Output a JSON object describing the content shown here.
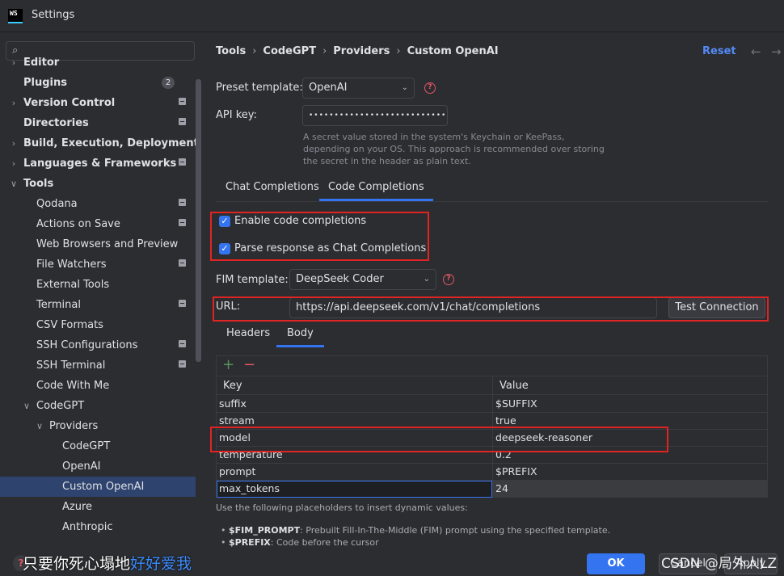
{
  "window": {
    "logo_text": "WS",
    "title": "Settings"
  },
  "sidebar": {
    "search": {
      "placeholder": ""
    },
    "items": [
      {
        "label": "Editor",
        "chevron": "›",
        "bold": true,
        "badge": false
      },
      {
        "label": "Plugins",
        "chevron": "",
        "bold": true,
        "count": "2"
      },
      {
        "label": "Version Control",
        "chevron": "›",
        "bold": true,
        "badge": true
      },
      {
        "label": "Directories",
        "chevron": "",
        "bold": true,
        "badge": true
      },
      {
        "label": "Build, Execution, Deployment",
        "chevron": "›",
        "bold": true,
        "badge": false
      },
      {
        "label": "Languages & Frameworks",
        "chevron": "›",
        "bold": true,
        "badge": true
      },
      {
        "label": "Tools",
        "chevron": "⌄",
        "bold": true,
        "badge": false
      },
      {
        "label": "Qodana",
        "chevron": "",
        "bold": false,
        "badge": true
      },
      {
        "label": "Actions on Save",
        "chevron": "",
        "bold": false,
        "badge": true
      },
      {
        "label": "Web Browsers and Preview",
        "chevron": "",
        "bold": false,
        "badge": false
      },
      {
        "label": "File Watchers",
        "chevron": "",
        "bold": false,
        "badge": true
      },
      {
        "label": "External Tools",
        "chevron": "",
        "bold": false,
        "badge": false
      },
      {
        "label": "Terminal",
        "chevron": "",
        "bold": false,
        "badge": true
      },
      {
        "label": "CSV Formats",
        "chevron": "",
        "bold": false,
        "badge": false
      },
      {
        "label": "SSH Configurations",
        "chevron": "",
        "bold": false,
        "badge": true
      },
      {
        "label": "SSH Terminal",
        "chevron": "",
        "bold": false,
        "badge": true
      },
      {
        "label": "Code With Me",
        "chevron": "",
        "bold": false,
        "badge": false
      },
      {
        "label": "CodeGPT",
        "chevron": "⌄",
        "bold": false,
        "badge": false
      },
      {
        "label": "Providers",
        "chevron": "⌄",
        "bold": false,
        "badge": false
      },
      {
        "label": "CodeGPT",
        "chevron": "",
        "bold": false,
        "badge": false
      },
      {
        "label": "OpenAI",
        "chevron": "",
        "bold": false,
        "badge": false
      },
      {
        "label": "Custom OpenAI",
        "chevron": "",
        "bold": false,
        "badge": false,
        "selected": true
      },
      {
        "label": "Azure",
        "chevron": "",
        "bold": false,
        "badge": false
      },
      {
        "label": "Anthropic",
        "chevron": "",
        "bold": false,
        "badge": false
      }
    ]
  },
  "breadcrumb": [
    "Tools",
    "CodeGPT",
    "Providers",
    "Custom OpenAI"
  ],
  "header": {
    "reset_label": "Reset"
  },
  "form": {
    "preset_label": "Preset template:",
    "preset_value": "OpenAI",
    "api_key_label": "API key:",
    "api_key_value": "•••••••••••••••••••••••••••••",
    "api_key_hint": "A secret value stored in the system's Keychain or KeePass, depending on your OS. This approach is recommended over storing the secret in the header as plain text."
  },
  "tabs": [
    {
      "label": "Chat Completions",
      "active": false
    },
    {
      "label": "Code Completions",
      "active": true
    }
  ],
  "code_completions": {
    "enable_label": "Enable code completions",
    "enable_checked": true,
    "parse_label": "Parse response as Chat Completions",
    "parse_checked": true,
    "fim_label": "FIM template:",
    "fim_value": "DeepSeek Coder",
    "url_label": "URL:",
    "url_value": "https://api.deepseek.com/v1/chat/completions",
    "test_button": "Test Connection"
  },
  "sub_tabs": [
    {
      "label": "Headers",
      "active": false
    },
    {
      "label": "Body",
      "active": true
    }
  ],
  "body_table": {
    "columns": [
      "Key",
      "Value"
    ],
    "rows": [
      {
        "key": "suffix",
        "value": "$SUFFIX"
      },
      {
        "key": "stream",
        "value": "true"
      },
      {
        "key": "model",
        "value": "deepseek-reasoner"
      },
      {
        "key": "temperature",
        "value": "0.2"
      },
      {
        "key": "prompt",
        "value": "$PREFIX"
      },
      {
        "key": "max_tokens",
        "value": "24",
        "editing": true
      }
    ]
  },
  "placeholders": {
    "intro": "Use the following placeholders to insert dynamic values:",
    "items": [
      {
        "name": "$FIM_PROMPT",
        "desc": ": Prebuilt Fill-In-The-Middle (FIM) prompt using the specified template."
      },
      {
        "name": "$PREFIX",
        "desc": ": Code before the cursor"
      }
    ]
  },
  "footer": {
    "help_label": "?",
    "ok_label": "OK",
    "cancel_label": "Cancel",
    "apply_label": "Apply",
    "overlay_text_white": "只要你死心塌地",
    "overlay_text_blue": "好好爱我",
    "watermark": "CSDN @局外人LZ"
  },
  "colors": {
    "accent": "#3574f0",
    "highlight_box": "#e02424",
    "help": "#e55765"
  }
}
